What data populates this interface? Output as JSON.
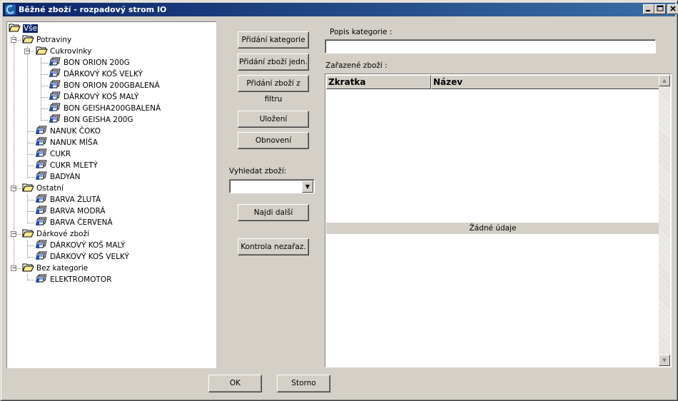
{
  "window": {
    "title": "Běžné zboží - rozpadový strom IO"
  },
  "tree": {
    "root": "Vše",
    "rows": [
      {
        "label": "Potraviny"
      },
      {
        "label": "Cukrovinky"
      },
      {
        "label": "BON ORION 200G"
      },
      {
        "label": "DÁRKOVÝ KOŠ VELKÝ"
      },
      {
        "label": "BON ORION 200GBALENÁ"
      },
      {
        "label": "DÁRKOVÝ KOŠ MALÝ"
      },
      {
        "label": "BON GEISHA200GBALENÁ"
      },
      {
        "label": "BON GEISHA 200G"
      },
      {
        "label": "NANUK ČOKO"
      },
      {
        "label": "NANUK MÍŠA"
      },
      {
        "label": "CUKR"
      },
      {
        "label": "CUKR MLETÝ"
      },
      {
        "label": "BADYÁN"
      },
      {
        "label": "Ostatní"
      },
      {
        "label": "BARVA ŽLUTÁ"
      },
      {
        "label": "BARVA MODRÁ"
      },
      {
        "label": "BARVA ČERVENÁ"
      },
      {
        "label": "Dárkové zboží"
      },
      {
        "label": "DÁRKOVÝ KOŠ MALÝ"
      },
      {
        "label": "DÁRKOVÝ KOŠ VELKÝ"
      },
      {
        "label": "Bez kategorie"
      },
      {
        "label": "ELEKTROMOTOR"
      }
    ]
  },
  "buttons": {
    "add_category": "Přidání kategorie",
    "add_item_unit": "Přidání zboží jedn.",
    "add_item_filter": "Přidání zboží z filtru",
    "save": "Uložení",
    "refresh": "Obnovení",
    "find_next": "Najdi další",
    "check_uncategorized": "Kontrola nezařaz.",
    "ok": "OK",
    "cancel": "Storno"
  },
  "search": {
    "label": "Vyhledat zboží:",
    "value": ""
  },
  "category_description": {
    "label": "Popis kategorie :",
    "value": ""
  },
  "assigned": {
    "label": "Zařazené zboží :",
    "columns": [
      "Zkratka",
      "Název"
    ],
    "empty_text": "Žádné údaje"
  },
  "colors": {
    "title_start": "#0a246a",
    "title_end": "#3a6ea5",
    "face": "#d4d0c8"
  }
}
